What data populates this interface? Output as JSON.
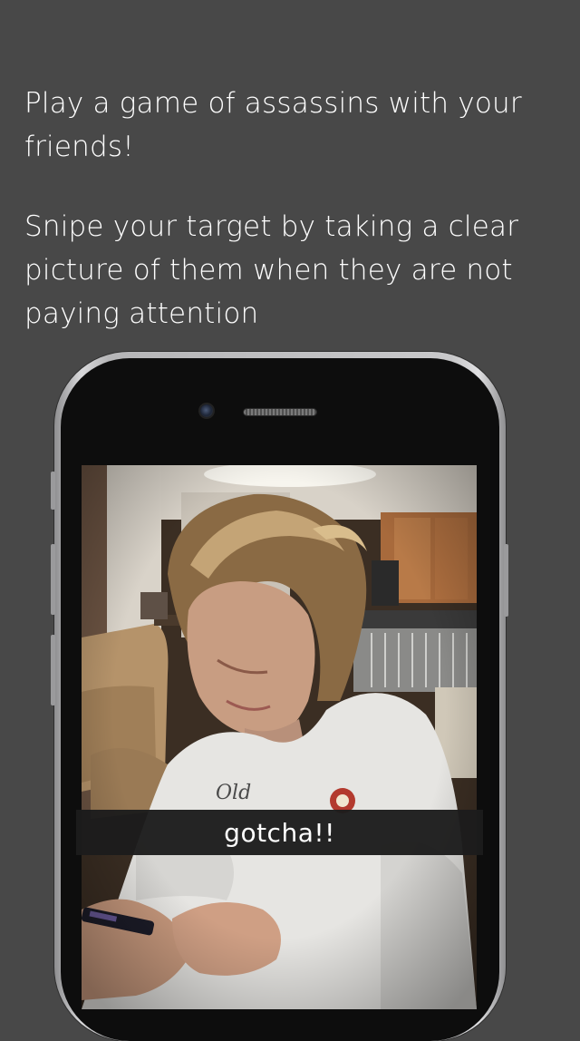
{
  "intro": {
    "line1": "Play a game of assassins with your friends!",
    "line2": "Snipe your target by taking a clear picture of them when they are not paying attention"
  },
  "phone": {
    "photo_caption": "gotcha!!"
  },
  "colors": {
    "background": "#484848",
    "text": "#ffffff",
    "caption_bar": "#1c1c1c"
  }
}
